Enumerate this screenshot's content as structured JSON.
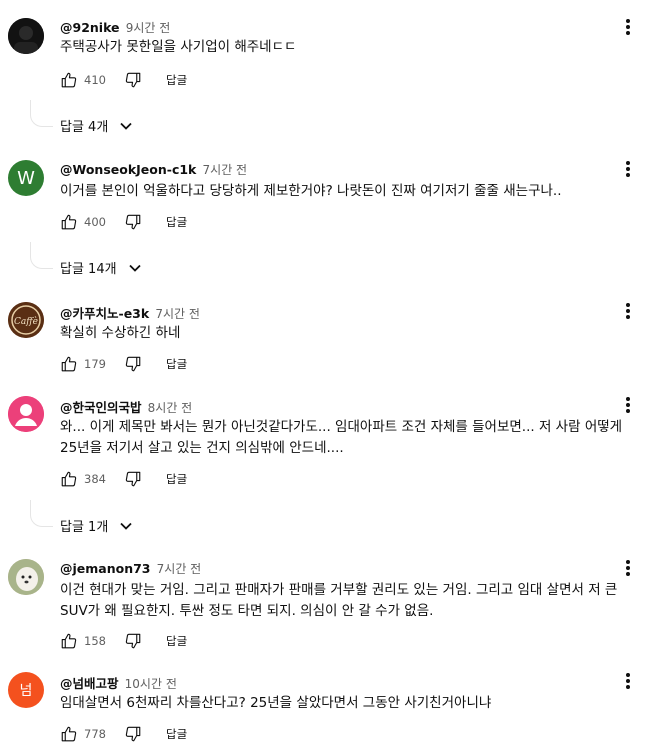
{
  "comments": [
    {
      "author": "@92nike",
      "time": "9시간 전",
      "text": "주택공사가 못한일을 사기업이 해주네ㄷㄷ",
      "likes": "410",
      "reply_label": "답글",
      "replies": "답글 4개",
      "avatar_kind": "dark",
      "avatar_letter": ""
    },
    {
      "author": "@WonseokJeon-c1k",
      "time": "7시간 전",
      "text": "이거를 본인이 억울하다고 당당하게 제보한거야? 나랏돈이 진짜 여기저기 줄줄 새는구나..",
      "likes": "400",
      "reply_label": "답글",
      "replies": "답글 14개",
      "avatar_kind": "letter",
      "avatar_letter": "W"
    },
    {
      "author": "@카푸치노-e3k",
      "time": "7시간 전",
      "text": "확실히 수상하긴 하네",
      "likes": "179",
      "reply_label": "답글",
      "replies": "",
      "avatar_kind": "coffee",
      "avatar_letter": "Caffè"
    },
    {
      "author": "@한국인의국밥",
      "time": "8시간 전",
      "text": "와... 이게 제목만 봐서는 뭔가 아닌것같다가도... 임대아파트 조건 자체를 들어보면... 저 사람 어떻게 25년을 저기서 살고 있는 건지 의심밖에 안드네....",
      "likes": "384",
      "reply_label": "답글",
      "replies": "답글 1개",
      "avatar_kind": "person",
      "avatar_letter": ""
    },
    {
      "author": "@jemanon73",
      "time": "7시간 전",
      "text": "이건 현대가 맞는 거임. 그리고 판매자가 판매를 거부할 권리도 있는 거임. 그리고 임대 살면서 저 큰 SUV가 왜 필요한지. 투싼 정도 타면 되지. 의심이 안 갈 수가 없음.",
      "likes": "158",
      "reply_label": "답글",
      "replies": "",
      "avatar_kind": "dog",
      "avatar_letter": ""
    },
    {
      "author": "@넘배고팡",
      "time": "10시간 전",
      "text": "임대살면서 6천짜리 차를산다고? 25년을 살았다면서 그동안 사기친거아니냐",
      "likes": "778",
      "reply_label": "답글",
      "replies": "",
      "avatar_kind": "letter2",
      "avatar_letter": "넘"
    }
  ],
  "colors": {
    "w_avatar": "#2e7d32",
    "person_avatar": "#e91e63",
    "neom_avatar": "#f4511e"
  }
}
